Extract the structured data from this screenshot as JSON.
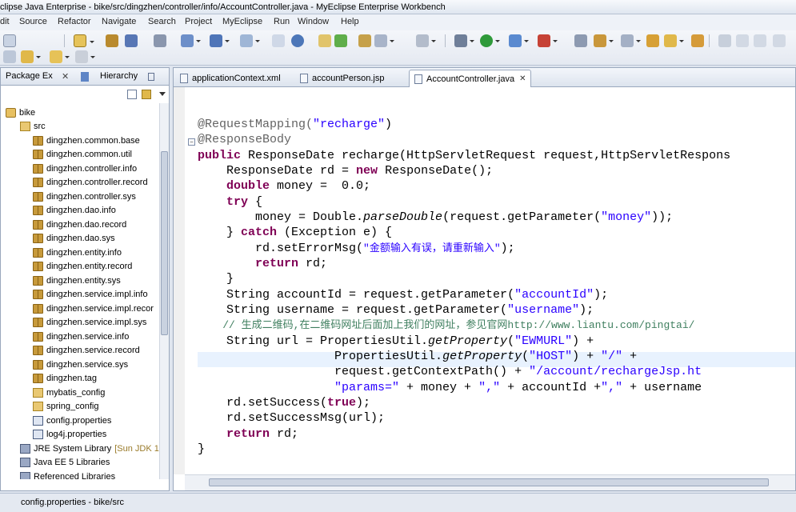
{
  "window": {
    "title": "clipse Java Enterprise - bike/src/dingzhen/controller/info/AccountController.java - MyEclipse Enterprise Workbench"
  },
  "menubar": [
    "dit",
    "Source",
    "Refactor",
    "Navigate",
    "Search",
    "Project",
    "MyEclipse",
    "Run",
    "Window",
    "Help"
  ],
  "package_explorer": {
    "tab_label": "Package Ex",
    "hierarchy_tab_label": "Hierarchy",
    "tree": [
      {
        "label": "bike",
        "icon": "project-icon",
        "level": 0
      },
      {
        "label": "src",
        "icon": "source-folder-icon",
        "level": 1
      },
      {
        "label": "dingzhen.common.base",
        "icon": "package-icon",
        "level": 2
      },
      {
        "label": "dingzhen.common.util",
        "icon": "package-icon",
        "level": 2
      },
      {
        "label": "dingzhen.controller.info",
        "icon": "package-icon",
        "level": 2
      },
      {
        "label": "dingzhen.controller.record",
        "icon": "package-icon",
        "level": 2
      },
      {
        "label": "dingzhen.controller.sys",
        "icon": "package-icon",
        "level": 2
      },
      {
        "label": "dingzhen.dao.info",
        "icon": "package-icon",
        "level": 2
      },
      {
        "label": "dingzhen.dao.record",
        "icon": "package-icon",
        "level": 2
      },
      {
        "label": "dingzhen.dao.sys",
        "icon": "package-icon",
        "level": 2
      },
      {
        "label": "dingzhen.entity.info",
        "icon": "package-icon",
        "level": 2
      },
      {
        "label": "dingzhen.entity.record",
        "icon": "package-icon",
        "level": 2
      },
      {
        "label": "dingzhen.entity.sys",
        "icon": "package-icon",
        "level": 2
      },
      {
        "label": "dingzhen.service.impl.info",
        "icon": "package-icon",
        "level": 2
      },
      {
        "label": "dingzhen.service.impl.recor",
        "icon": "package-icon",
        "level": 2
      },
      {
        "label": "dingzhen.service.impl.sys",
        "icon": "package-icon",
        "level": 2
      },
      {
        "label": "dingzhen.service.info",
        "icon": "package-icon",
        "level": 2
      },
      {
        "label": "dingzhen.service.record",
        "icon": "package-icon",
        "level": 2
      },
      {
        "label": "dingzhen.service.sys",
        "icon": "package-icon",
        "level": 2
      },
      {
        "label": "dingzhen.tag",
        "icon": "package-icon",
        "level": 2
      },
      {
        "label": "mybatis_config",
        "icon": "folder-icon",
        "level": 2
      },
      {
        "label": "spring_config",
        "icon": "folder-icon",
        "level": 2
      },
      {
        "label": "config.properties",
        "icon": "properties-file-icon",
        "level": 2
      },
      {
        "label": "log4j.properties",
        "icon": "properties-file-icon",
        "level": 2
      },
      {
        "label": "JRE System Library",
        "suffix": "[Sun JDK 1",
        "icon": "library-icon",
        "level": 1
      },
      {
        "label": "Java EE 5 Libraries",
        "icon": "library-icon",
        "level": 1
      },
      {
        "label": "Referenced Libraries",
        "icon": "library-icon",
        "level": 1
      }
    ]
  },
  "editor": {
    "tabs": [
      {
        "label": "applicationContext.xml",
        "active": false
      },
      {
        "label": "accountPerson.jsp",
        "active": false
      },
      {
        "label": "AccountController.java",
        "active": true
      }
    ],
    "code": {
      "l1_ann": "@RequestMapping(",
      "l1_str": "\"recharge\"",
      "l1_end": ")",
      "l2_ann": "@ResponseBody",
      "l3_kw": "public",
      "l3_rest": " ResponseDate recharge(HttpServletRequest request,HttpServletRespons",
      "l4_a": "    ResponseDate rd = ",
      "l4_kw": "new",
      "l4_b": " ResponseDate();",
      "l5_kw": "    double",
      "l5_rest": " money =  0.0;",
      "l6_kw": "    try",
      "l6_rest": " {",
      "l7_a": "        money = Double.",
      "l7_it": "parseDouble",
      "l7_b": "(request.getParameter(",
      "l7_str": "\"money\"",
      "l7_c": "));",
      "l8_a": "    } ",
      "l8_kw": "catch",
      "l8_b": " (Exception e) {",
      "l9_a": "        rd.setErrorMsg(",
      "l9_str": "\"金额输入有误，请重新输入\"",
      "l9_b": ");",
      "l10_kw": "        return",
      "l10_rest": " rd;",
      "l11": "    }",
      "l12_a": "    String accountId = request.getParameter(",
      "l12_str": "\"accountId\"",
      "l12_b": ");",
      "l13_a": "    String username = request.getParameter(",
      "l13_str": "\"username\"",
      "l13_b": ");",
      "l14_cm": "    // 生成二维码,在二维码网址后面加上我们的网址，参见官网http://www.liantu.com/pingtai/",
      "l15_a": "    String url = PropertiesUtil.",
      "l15_it": "getProperty",
      "l15_b": "(",
      "l15_str": "\"EWMURL\"",
      "l15_c": ") +",
      "l16_a": "                   PropertiesUtil.",
      "l16_it": "getProperty",
      "l16_b": "(",
      "l16_str": "\"HOST\"",
      "l16_c": ") + ",
      "l16_str2": "\"/\"",
      "l16_d": " +",
      "l17_a": "                   request.getContextPath() + ",
      "l17_str": "\"/account/rechargeJsp.ht",
      "l18_a": "                   ",
      "l18_str": "\"params=\"",
      "l18_b": " + money + ",
      "l18_str2": "\",\"",
      "l18_c": " + accountId +",
      "l18_str3": "\",\"",
      "l18_d": " + username",
      "l19_a": "    rd.setSuccess(",
      "l19_kw": "true",
      "l19_b": ");",
      "l20": "    rd.setSuccessMsg(url);",
      "l21_kw": "    return",
      "l21_rest": " rd;",
      "l22": "}"
    }
  },
  "status": {
    "text": "config.properties - bike/src"
  }
}
